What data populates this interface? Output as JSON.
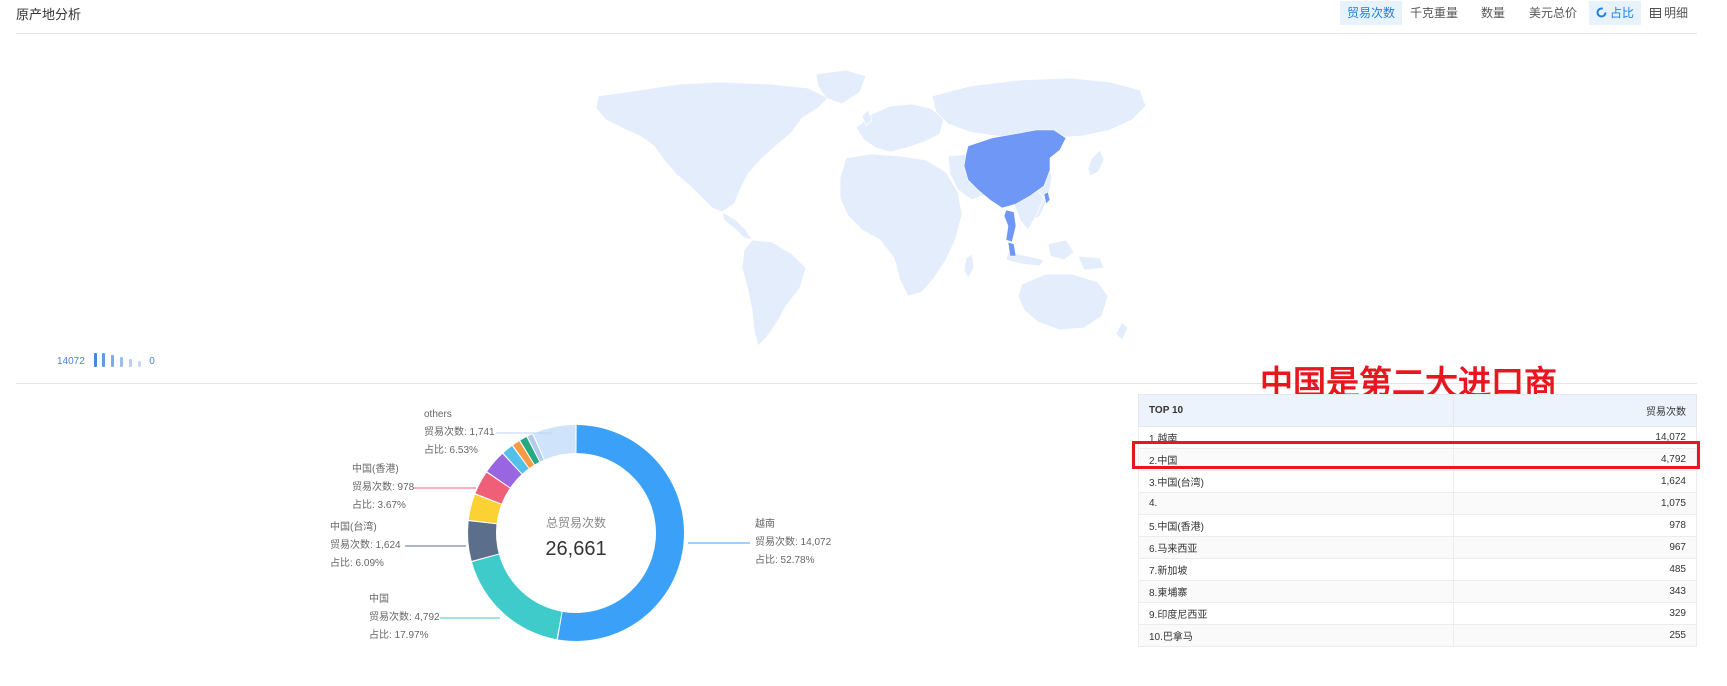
{
  "header": {
    "title": "原产地分析",
    "metric_tabs": [
      "贸易次数",
      "千克重量",
      "数量",
      "美元总价"
    ],
    "view_tabs": [
      "占比",
      "明细"
    ]
  },
  "map": {
    "legend_max": "14072",
    "legend_min": "0",
    "highlight_color": "#6f97f5",
    "base_color": "#e4edfc"
  },
  "donut": {
    "center_label": "总贸易次数",
    "center_value": "26,661",
    "labels": [
      {
        "name": "越南",
        "count": "贸易次数: 14,072",
        "pct": "占比: 52.78%"
      },
      {
        "name": "中国",
        "count": "贸易次数: 4,792",
        "pct": "占比: 17.97%"
      },
      {
        "name": "中国(台湾)",
        "count": "贸易次数: 1,624",
        "pct": "占比: 6.09%"
      },
      {
        "name": "中国(香港)",
        "count": "贸易次数: 978",
        "pct": "占比: 3.67%"
      },
      {
        "name": "others",
        "count": "贸易次数: 1,741",
        "pct": "占比: 6.53%"
      }
    ]
  },
  "chart_data": {
    "type": "pie",
    "categories": [
      "越南",
      "中国",
      "中国(台湾)",
      "",
      "中国(香港)",
      "马来西亚",
      "新加坡",
      "柬埔寨",
      "印度尼西亚",
      "巴拿马",
      "others"
    ],
    "values": [
      14072,
      4792,
      1624,
      1075,
      978,
      967,
      485,
      343,
      329,
      255,
      1741
    ],
    "colors": [
      "#3ba1f8",
      "#3ecbca",
      "#5b6f8d",
      "#fbd133",
      "#ef5f77",
      "#9a65e0",
      "#53c0ea",
      "#f69a44",
      "#27a884",
      "#b1cbe9",
      "#cfe3fb"
    ]
  },
  "annotation": "中国是第二大进口商",
  "table": {
    "header_rank": "TOP 10",
    "header_value": "贸易次数",
    "rows": [
      {
        "label": "1.越南",
        "value": "14,072"
      },
      {
        "label": "2.中国",
        "value": "4,792"
      },
      {
        "label": "3.中国(台湾)",
        "value": "1,624"
      },
      {
        "label": "4.",
        "value": "1,075"
      },
      {
        "label": "5.中国(香港)",
        "value": "978"
      },
      {
        "label": "6.马来西亚",
        "value": "967"
      },
      {
        "label": "7.新加坡",
        "value": "485"
      },
      {
        "label": "8.柬埔寨",
        "value": "343"
      },
      {
        "label": "9.印度尼西亚",
        "value": "329"
      },
      {
        "label": "10.巴拿马",
        "value": "255"
      }
    ]
  }
}
